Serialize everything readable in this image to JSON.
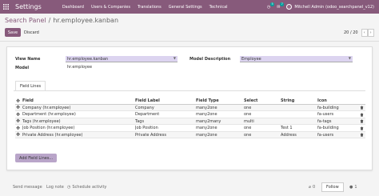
{
  "navbar": {
    "brand": "Settings",
    "menu": [
      "Dashboard",
      "Users & Companies",
      "Translations",
      "General Settings",
      "Technical"
    ],
    "activity_badge": "5",
    "messages_badge": "7",
    "user": "Mitchell Admin (odoo_searchpanel_v12)",
    "bg_color": "#875a7b"
  },
  "breadcrumb": {
    "parent": "Search Panel",
    "separator": "/",
    "current": "hr.employee.kanban"
  },
  "actions": {
    "save": "Save",
    "discard": "Discard"
  },
  "pager": {
    "value": "20 / 20",
    "prev": "‹",
    "next": "›"
  },
  "form": {
    "view_name_label": "View Name",
    "view_name_value": "hr.employee.kanban",
    "model_label": "Model",
    "model_value": "hr.employee",
    "model_desc_label": "Model Description",
    "model_desc_value": "Employee"
  },
  "tab": {
    "label": "Field Lines"
  },
  "table": {
    "headers": [
      "Field",
      "Field Label",
      "Field Type",
      "Select",
      "String",
      "Icon"
    ],
    "rows": [
      [
        "Company (hr.employee)",
        "Company",
        "many2one",
        "one",
        "",
        "fa-building"
      ],
      [
        "Department (hr.employee)",
        "Department",
        "many2one",
        "one",
        "",
        "fa-users"
      ],
      [
        "Tags (hr.employee)",
        "Tags",
        "many2many",
        "multi",
        "",
        "fa-tags"
      ],
      [
        "Job Position (hr.employee)",
        "Job Position",
        "many2one",
        "one",
        "Test 1",
        "fa-building"
      ],
      [
        "Private Address (hr.employee)",
        "Private Address",
        "many2one",
        "one",
        "Address",
        "fa-users"
      ]
    ]
  },
  "add_button": "Add Field Lines...",
  "chatter": {
    "send_message": "Send message",
    "log_note": "Log note",
    "schedule": "Schedule activity",
    "attachments": "0",
    "follow": "Follow",
    "followers": "1"
  }
}
